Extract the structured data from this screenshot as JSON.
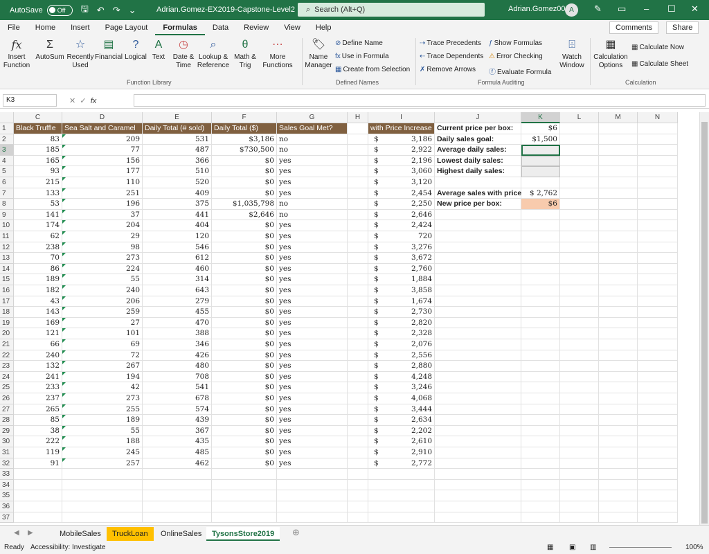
{
  "titlebar": {
    "autosave_label": "AutoSave",
    "autosave_state": "Off",
    "doc_title": "Adrian.Gomez-EX2019-Capstone-Level2 ∨",
    "search_placeholder": "Search (Alt+Q)",
    "user_name": "Adrian.Gomez004",
    "avatar_initial": "A"
  },
  "menu": {
    "tabs": [
      "File",
      "Home",
      "Insert",
      "Page Layout",
      "Formulas",
      "Data",
      "Review",
      "View",
      "Help"
    ],
    "active_tab": "Formulas",
    "comments_label": "Comments",
    "share_label": "Share"
  },
  "ribbon": {
    "insert_function": "Insert Function",
    "autosum": "AutoSum",
    "recently_used": "Recently Used",
    "financial": "Financial",
    "logical": "Logical",
    "text": "Text",
    "date_time": "Date & Time",
    "lookup_ref": "Lookup & Reference",
    "math_trig": "Math & Trig",
    "more_functions": "More Functions",
    "function_library_label": "Function Library",
    "name_manager": "Name Manager",
    "define_name": "Define Name",
    "use_in_formula": "Use in Formula",
    "create_from_selection": "Create from Selection",
    "defined_names_label": "Defined Names",
    "trace_precedents": "Trace Precedents",
    "trace_dependents": "Trace Dependents",
    "remove_arrows": "Remove Arrows",
    "show_formulas": "Show Formulas",
    "error_checking": "Error Checking",
    "evaluate_formula": "Evaluate Formula",
    "watch_window": "Watch Window",
    "formula_auditing_label": "Formula Auditing",
    "calculation_options": "Calculation Options",
    "calculate_now": "Calculate Now",
    "calculate_sheet": "Calculate Sheet",
    "calculation_label": "Calculation"
  },
  "formula_bar": {
    "name_box": "K3",
    "formula": ""
  },
  "columns": [
    "C",
    "D",
    "E",
    "F",
    "G",
    "H",
    "I",
    "J",
    "K",
    "L",
    "M",
    "N"
  ],
  "selected_column": "K",
  "selected_row": 3,
  "headers": {
    "C": "Black Truffle",
    "D": "Sea Salt and Caramel",
    "E": "Daily Total (# sold)",
    "F": "Daily Total ($)",
    "G": "Sales Goal Met?",
    "I": "with Price Increase"
  },
  "rows": [
    {
      "c": "83",
      "d": "209",
      "e": "531",
      "f": "$3,186",
      "g": "no",
      "i": "3,186"
    },
    {
      "c": "185",
      "d": "77",
      "e": "487",
      "f": "$730,500",
      "g": "no",
      "i": "2,922"
    },
    {
      "c": "165",
      "d": "156",
      "e": "366",
      "f": "$0",
      "g": "yes",
      "i": "2,196"
    },
    {
      "c": "93",
      "d": "177",
      "e": "510",
      "f": "$0",
      "g": "yes",
      "i": "3,060"
    },
    {
      "c": "215",
      "d": "110",
      "e": "520",
      "f": "$0",
      "g": "yes",
      "i": "3,120"
    },
    {
      "c": "133",
      "d": "251",
      "e": "409",
      "f": "$0",
      "g": "yes",
      "i": "2,454"
    },
    {
      "c": "53",
      "d": "196",
      "e": "375",
      "f": "$1,035,798",
      "g": "no",
      "i": "2,250"
    },
    {
      "c": "141",
      "d": "37",
      "e": "441",
      "f": "$2,646",
      "g": "no",
      "i": "2,646"
    },
    {
      "c": "174",
      "d": "204",
      "e": "404",
      "f": "$0",
      "g": "yes",
      "i": "2,424"
    },
    {
      "c": "62",
      "d": "29",
      "e": "120",
      "f": "$0",
      "g": "yes",
      "i": "720"
    },
    {
      "c": "238",
      "d": "98",
      "e": "546",
      "f": "$0",
      "g": "yes",
      "i": "3,276"
    },
    {
      "c": "70",
      "d": "273",
      "e": "612",
      "f": "$0",
      "g": "yes",
      "i": "3,672"
    },
    {
      "c": "86",
      "d": "224",
      "e": "460",
      "f": "$0",
      "g": "yes",
      "i": "2,760"
    },
    {
      "c": "189",
      "d": "55",
      "e": "314",
      "f": "$0",
      "g": "yes",
      "i": "1,884"
    },
    {
      "c": "182",
      "d": "240",
      "e": "643",
      "f": "$0",
      "g": "yes",
      "i": "3,858"
    },
    {
      "c": "43",
      "d": "206",
      "e": "279",
      "f": "$0",
      "g": "yes",
      "i": "1,674"
    },
    {
      "c": "143",
      "d": "259",
      "e": "455",
      "f": "$0",
      "g": "yes",
      "i": "2,730"
    },
    {
      "c": "169",
      "d": "27",
      "e": "470",
      "f": "$0",
      "g": "yes",
      "i": "2,820"
    },
    {
      "c": "121",
      "d": "101",
      "e": "388",
      "f": "$0",
      "g": "yes",
      "i": "2,328"
    },
    {
      "c": "66",
      "d": "69",
      "e": "346",
      "f": "$0",
      "g": "yes",
      "i": "2,076"
    },
    {
      "c": "240",
      "d": "72",
      "e": "426",
      "f": "$0",
      "g": "yes",
      "i": "2,556"
    },
    {
      "c": "132",
      "d": "267",
      "e": "480",
      "f": "$0",
      "g": "yes",
      "i": "2,880"
    },
    {
      "c": "241",
      "d": "194",
      "e": "708",
      "f": "$0",
      "g": "yes",
      "i": "4,248"
    },
    {
      "c": "233",
      "d": "42",
      "e": "541",
      "f": "$0",
      "g": "yes",
      "i": "3,246"
    },
    {
      "c": "237",
      "d": "273",
      "e": "678",
      "f": "$0",
      "g": "yes",
      "i": "4,068"
    },
    {
      "c": "265",
      "d": "255",
      "e": "574",
      "f": "$0",
      "g": "yes",
      "i": "3,444"
    },
    {
      "c": "85",
      "d": "189",
      "e": "439",
      "f": "$0",
      "g": "yes",
      "i": "2,634"
    },
    {
      "c": "38",
      "d": "55",
      "e": "367",
      "f": "$0",
      "g": "yes",
      "i": "2,202"
    },
    {
      "c": "222",
      "d": "188",
      "e": "435",
      "f": "$0",
      "g": "yes",
      "i": "2,610"
    },
    {
      "c": "119",
      "d": "245",
      "e": "485",
      "f": "$0",
      "g": "yes",
      "i": "2,910"
    },
    {
      "c": "91",
      "d": "257",
      "e": "462",
      "f": "$0",
      "g": "yes",
      "i": "2,772"
    }
  ],
  "currency_symbol": "$",
  "summary": [
    {
      "label": "Current price per box:",
      "value": "$6",
      "style": "plain"
    },
    {
      "label": "Daily sales goal:",
      "value": "$1,500",
      "style": "plain"
    },
    {
      "label": "Average daily sales:",
      "value": "",
      "style": "active"
    },
    {
      "label": "Lowest daily sales:",
      "value": "",
      "style": "gray"
    },
    {
      "label": "Highest daily sales:",
      "value": "",
      "style": "gray"
    },
    {
      "label": "",
      "value": "",
      "style": "none"
    },
    {
      "label": "Average sales with price",
      "value": "$   2,762",
      "style": "plain"
    },
    {
      "label": "New price per box:",
      "value": "$6",
      "style": "peach"
    }
  ],
  "sheets": [
    "MobileSales",
    "TruckLoan",
    "OnlineSales",
    "TysonsStore2019"
  ],
  "active_sheet": "TysonsStore2019",
  "status": {
    "ready": "Ready",
    "accessibility": "Accessibility: Investigate",
    "zoom": "100%"
  },
  "colors": {
    "excel_green": "#217346",
    "header_brown": "#806040",
    "tab_orange": "#ffc000",
    "peach": "#f8cbad"
  }
}
